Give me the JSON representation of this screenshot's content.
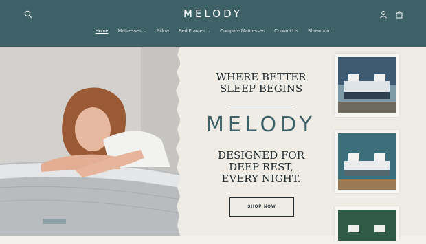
{
  "header": {
    "logo_text": "MELODY",
    "icons": {
      "search": "search-icon",
      "account": "user-icon",
      "cart": "bag-icon"
    }
  },
  "nav": {
    "items": [
      {
        "label": "Home",
        "active": true,
        "dropdown": false
      },
      {
        "label": "Mattresses",
        "active": false,
        "dropdown": true
      },
      {
        "label": "Pillow",
        "active": false,
        "dropdown": false
      },
      {
        "label": "Bed Frames",
        "active": false,
        "dropdown": true
      },
      {
        "label": "Compare Mattresses",
        "active": false,
        "dropdown": false
      },
      {
        "label": "Contact Us",
        "active": false,
        "dropdown": false
      },
      {
        "label": "Showroom",
        "active": false,
        "dropdown": false
      }
    ]
  },
  "hero": {
    "headline_line1": "WHERE BETTER",
    "headline_line2": "SLEEP BEGINS",
    "brand": "MELODY",
    "sub_line1": "DESIGNED FOR",
    "sub_line2": "DEEP REST,",
    "sub_line3": "EVERY NIGHT.",
    "cta_label": "SHOP NOW"
  },
  "colors": {
    "header_bg": "#3e6168",
    "brand_teal": "#3e6168",
    "paper": "#efece6",
    "ink": "#1e2b2f"
  }
}
